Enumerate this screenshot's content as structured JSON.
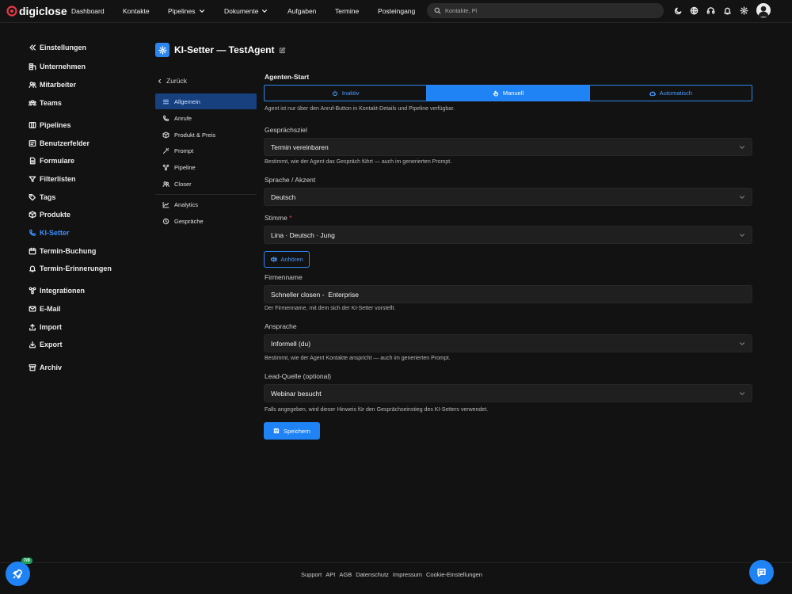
{
  "app": {
    "name": "digiclose",
    "brand_color": "#e63946",
    "accent": "#1f82f5"
  },
  "topnav": {
    "links": [
      "Dashboard",
      "Kontakte",
      "Pipelines",
      "Dokumente",
      "Aufgaben",
      "Termine",
      "Posteingang"
    ],
    "search_placeholder": "Kontakte, Pi",
    "icons": [
      "moon-icon",
      "globe-icon",
      "headset-icon",
      "bell-icon",
      "gear-icon",
      "user-avatar"
    ]
  },
  "sidebar": {
    "header": "Einstellungen",
    "groups": [
      [
        "Unternehmen",
        "Mitarbeiter",
        "Teams"
      ],
      [
        "Pipelines",
        "Benutzerfelder",
        "Formulare",
        "Filterlisten",
        "Tags",
        "Produkte",
        "KI-Setter",
        "Termin-Buchung",
        "Termin-Erinnerungen"
      ],
      [
        "Integrationen",
        "E-Mail",
        "Import",
        "Export"
      ],
      [
        "Archiv"
      ]
    ],
    "active": "KI-Setter"
  },
  "page": {
    "title": "KI-Setter — TestAgent"
  },
  "subnav": {
    "back": "Zurück",
    "items": [
      "Allgemein",
      "Anrufe",
      "Produkt & Preis",
      "Prompt",
      "Pipeline",
      "Closer"
    ],
    "items2": [
      "Analytics",
      "Gespräche"
    ],
    "active": "Allgemein"
  },
  "form": {
    "start": {
      "label": "Agenten-Start",
      "options": [
        "Inaktiv",
        "Manuell",
        "Automatisch"
      ],
      "selected": "Manuell",
      "help": "Agent ist nur über den Anruf-Button in Kontakt-Details und Pipeline verfügbar."
    },
    "goal": {
      "label": "Gesprächsziel",
      "value": "Termin vereinbaren",
      "help": "Bestimmt, wie der Agent das Gespräch führt — auch im generierten Prompt."
    },
    "language": {
      "label": "Sprache / Akzent",
      "value": "Deutsch"
    },
    "voice": {
      "label": "Stimme",
      "required_mark": "*",
      "value": "Lina · Deutsch · Jung",
      "listen": "Anhören"
    },
    "company": {
      "label": "Firmenname",
      "value": "Schneller closen -  Enterprise",
      "help": "Der Firmenname, mit dem sich der KI-Setter vorstellt."
    },
    "address": {
      "label": "Ansprache",
      "value": "Informell (du)",
      "help": "Bestimmt, wie der Agent Kontakte anspricht — auch im generierten Prompt."
    },
    "lead_source": {
      "label": "Lead-Quelle (optional)",
      "value": "Webinar besucht",
      "help": "Falls angegeben, wird dieser Hinweis für den Gesprächseinstieg des KI-Setters verwendet."
    },
    "save": "Speichern"
  },
  "footer": {
    "links": [
      "Support",
      "API",
      "AGB",
      "Datenschutz",
      "Impressum",
      "Cookie-Einstellungen"
    ]
  },
  "widgets": {
    "progress_badge": "7/8"
  }
}
